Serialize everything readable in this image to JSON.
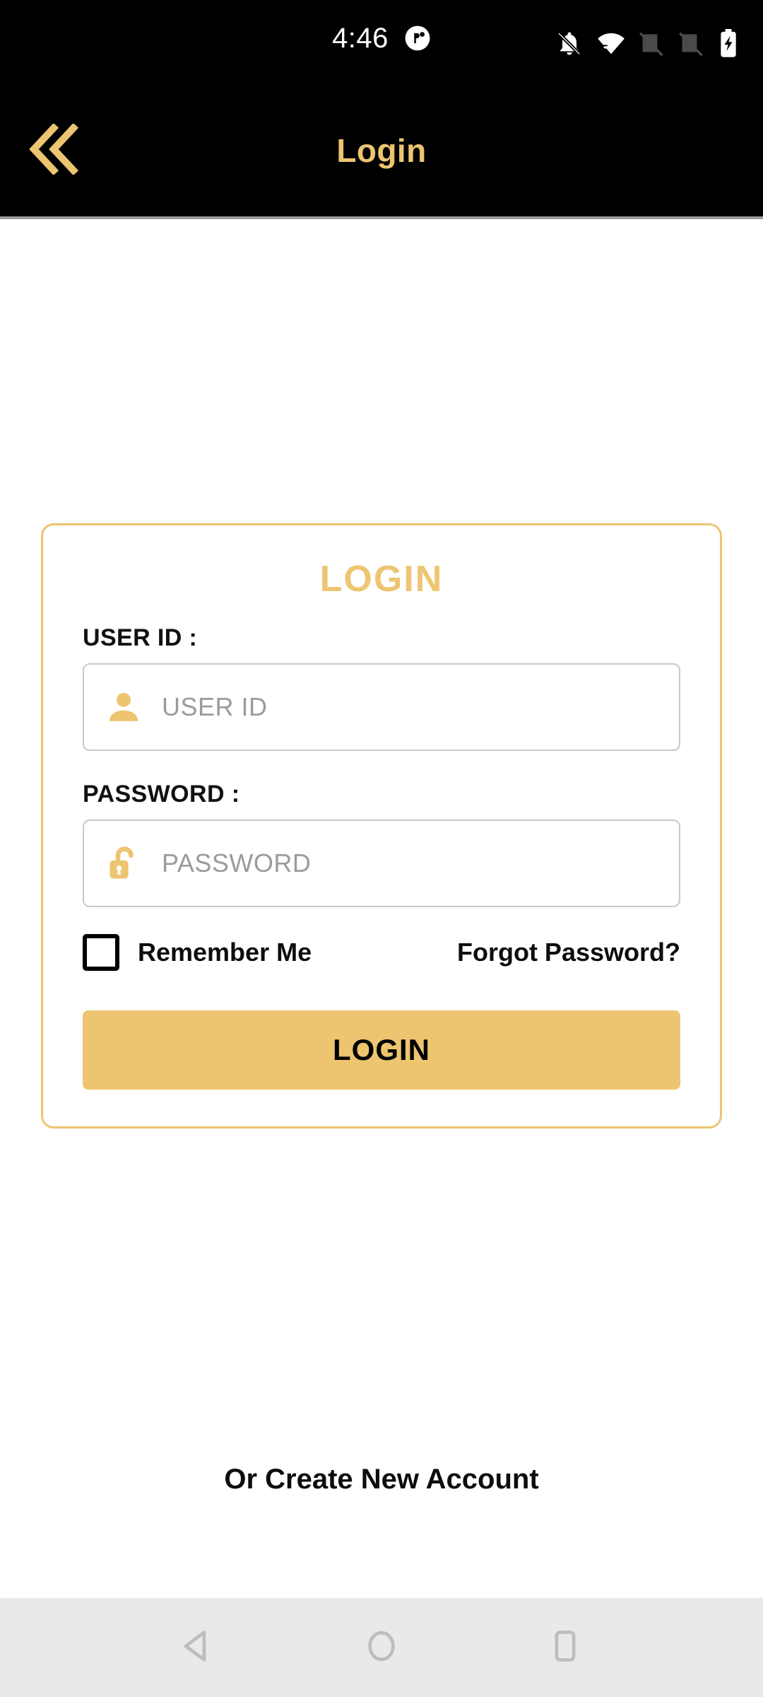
{
  "status_bar": {
    "time": "4:46",
    "notification_icon": "notification-dot-icon",
    "icons": [
      "notifications-silenced-icon",
      "wifi-icon",
      "sim-1-no-signal-icon",
      "sim-2-no-signal-icon",
      "battery-charging-icon"
    ]
  },
  "app_bar": {
    "back_icon": "double-chevron-left-icon",
    "title": "Login"
  },
  "login_card": {
    "heading": "LOGIN",
    "user_id": {
      "label": "USER ID :",
      "placeholder": "USER ID",
      "value": "",
      "icon": "person-icon"
    },
    "password": {
      "label": "PASSWORD :",
      "placeholder": "PASSWORD",
      "value": "",
      "icon": "unlocked-padlock-icon"
    },
    "remember_me": {
      "label": "Remember Me",
      "checked": false
    },
    "forgot_password": "Forgot Password?",
    "submit_label": "LOGIN"
  },
  "create_account": "Or Create New Account",
  "nav_bar": {
    "back": "back-triangle-icon",
    "home": "home-circle-icon",
    "recents": "recents-square-icon"
  },
  "colors": {
    "gold": "#edc470",
    "gold_heading": "#eec572",
    "app_bar_bg": "#000000",
    "page_bg": "#ffffff",
    "placeholder": "#9b9b9b",
    "input_border": "#c9c9c9",
    "nav_bar_bg": "#e9e9e9",
    "nav_icon": "#bdbdbd"
  }
}
